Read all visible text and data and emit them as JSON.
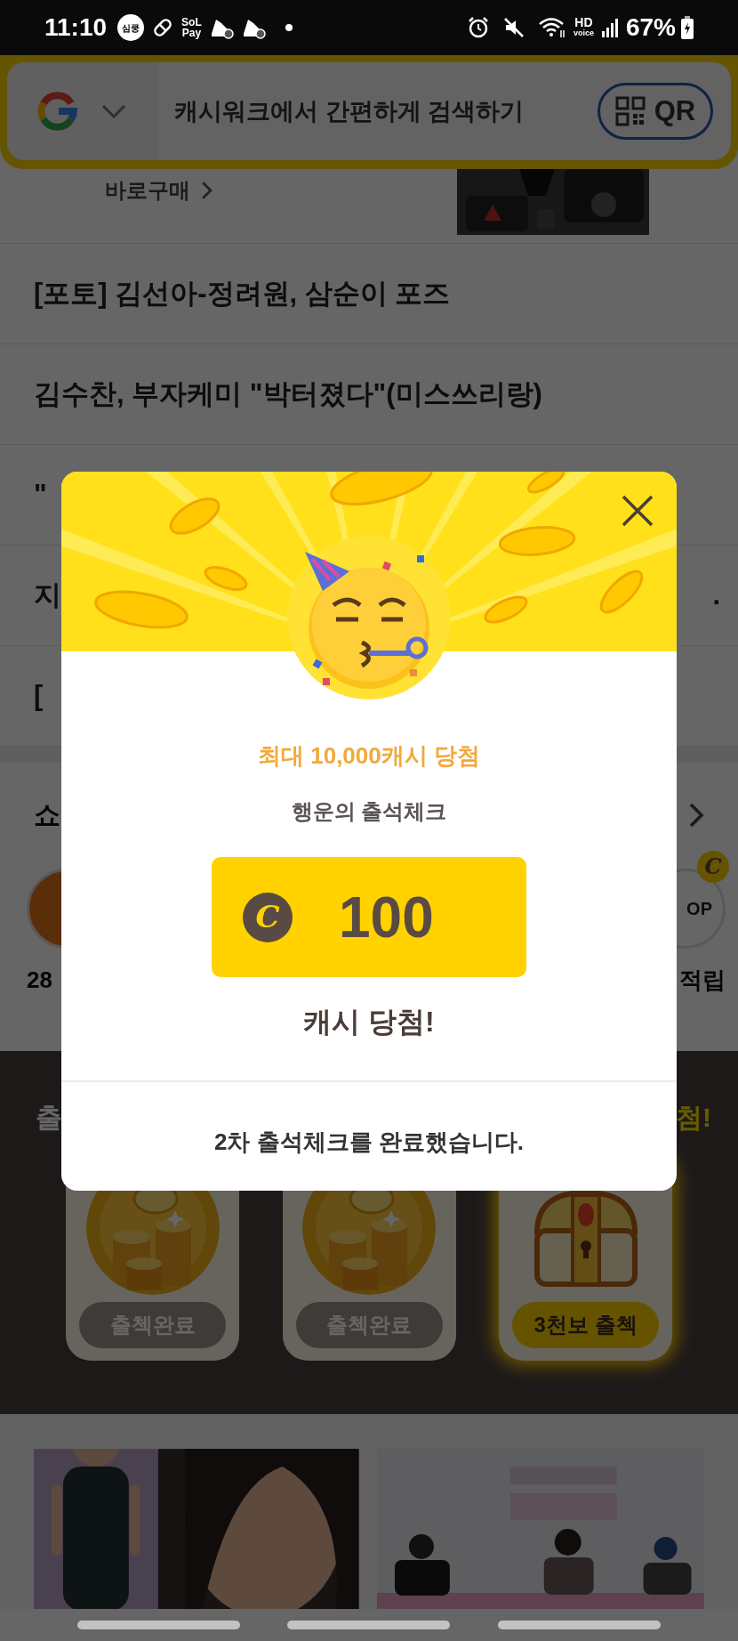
{
  "status_bar": {
    "time": "11:10",
    "chat_badge": "심쿵",
    "pay_logo_top": "SoL",
    "pay_logo_bottom": "Pay",
    "call_label_top": "HD",
    "call_label_bottom": "voice",
    "battery": "67%"
  },
  "search_bar": {
    "placeholder": "캐시워크에서 간편하게 검색하기",
    "qr_button": "QR"
  },
  "product": {
    "buy_link": "바로구매"
  },
  "news": [
    {
      "title": "[포토] 김선아-정려원, 삼순이 포즈"
    },
    {
      "title": "김수찬, 부자케미 \"박터졌다\"(미스쓰리랑)"
    },
    {
      "title": "\""
    },
    {
      "title": "지",
      "end": "."
    },
    {
      "title": "["
    }
  ],
  "shortcuts": {
    "title": "쇼",
    "left_label": "28",
    "right_label": "적립",
    "right_inner": "OP",
    "coin_symbol": "C"
  },
  "attendance": {
    "title": "출",
    "title_end": "첨!",
    "cards": [
      {
        "kind": "coins",
        "button": "출첵완료",
        "done": true
      },
      {
        "kind": "coins",
        "button": "출첵완료",
        "done": true
      },
      {
        "kind": "chest",
        "button": "3천보 출첵",
        "done": false
      }
    ]
  },
  "popup": {
    "headline": "최대 10,000캐시 당첨",
    "subtitle": "행운의 출석체크",
    "currency_symbol": "C",
    "amount": "100",
    "result": "캐시 당첨!",
    "message": "2차 출석체크를 완료했습니다."
  }
}
